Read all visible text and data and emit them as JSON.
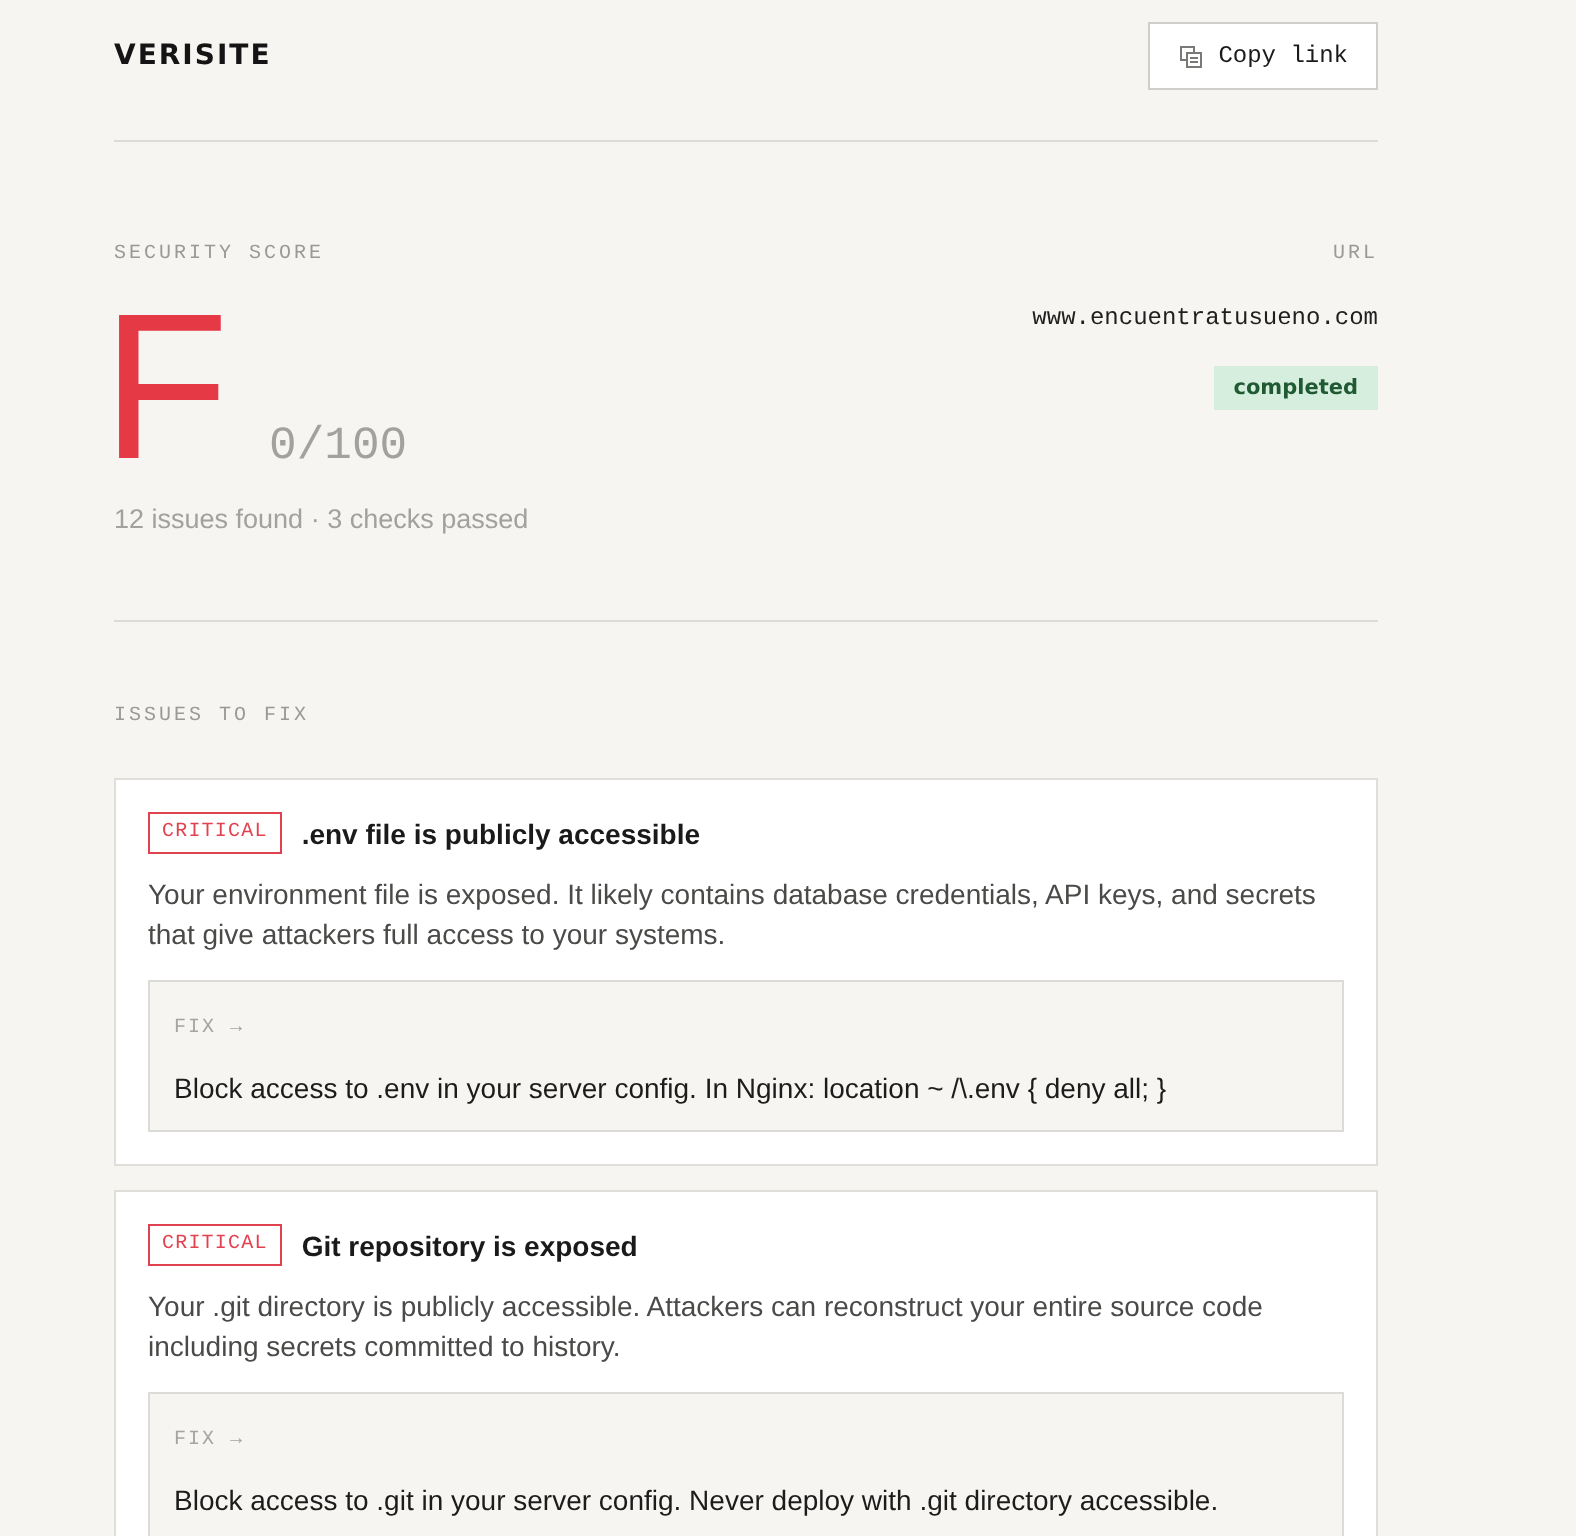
{
  "header": {
    "logo": "VERISITE",
    "copy_button": {
      "label": "Copy link"
    }
  },
  "score": {
    "label": "SECURITY SCORE",
    "grade": "F",
    "points": "0/100",
    "summary": "12 issues found · 3 checks passed"
  },
  "site": {
    "label": "URL",
    "url": "www.encuentratusueno.com",
    "status": "completed"
  },
  "issues_section": {
    "title": "ISSUES TO FIX",
    "issues": [
      {
        "severity": "CRITICAL",
        "title": ".env file is publicly accessible",
        "description": "Your environment file is exposed. It likely contains database credentials, API keys, and secrets that give attackers full access to your systems.",
        "fix_label": "FIX →",
        "fix": "Block access to .env in your server config. In Nginx: location ~ /\\.env { deny all; }"
      },
      {
        "severity": "CRITICAL",
        "title": "Git repository is exposed",
        "description": "Your .git directory is publicly accessible. Attackers can reconstruct your entire source code including secrets committed to history.",
        "fix_label": "FIX →",
        "fix": "Block access to .git in your server config. Never deploy with .git directory accessible."
      }
    ]
  }
}
